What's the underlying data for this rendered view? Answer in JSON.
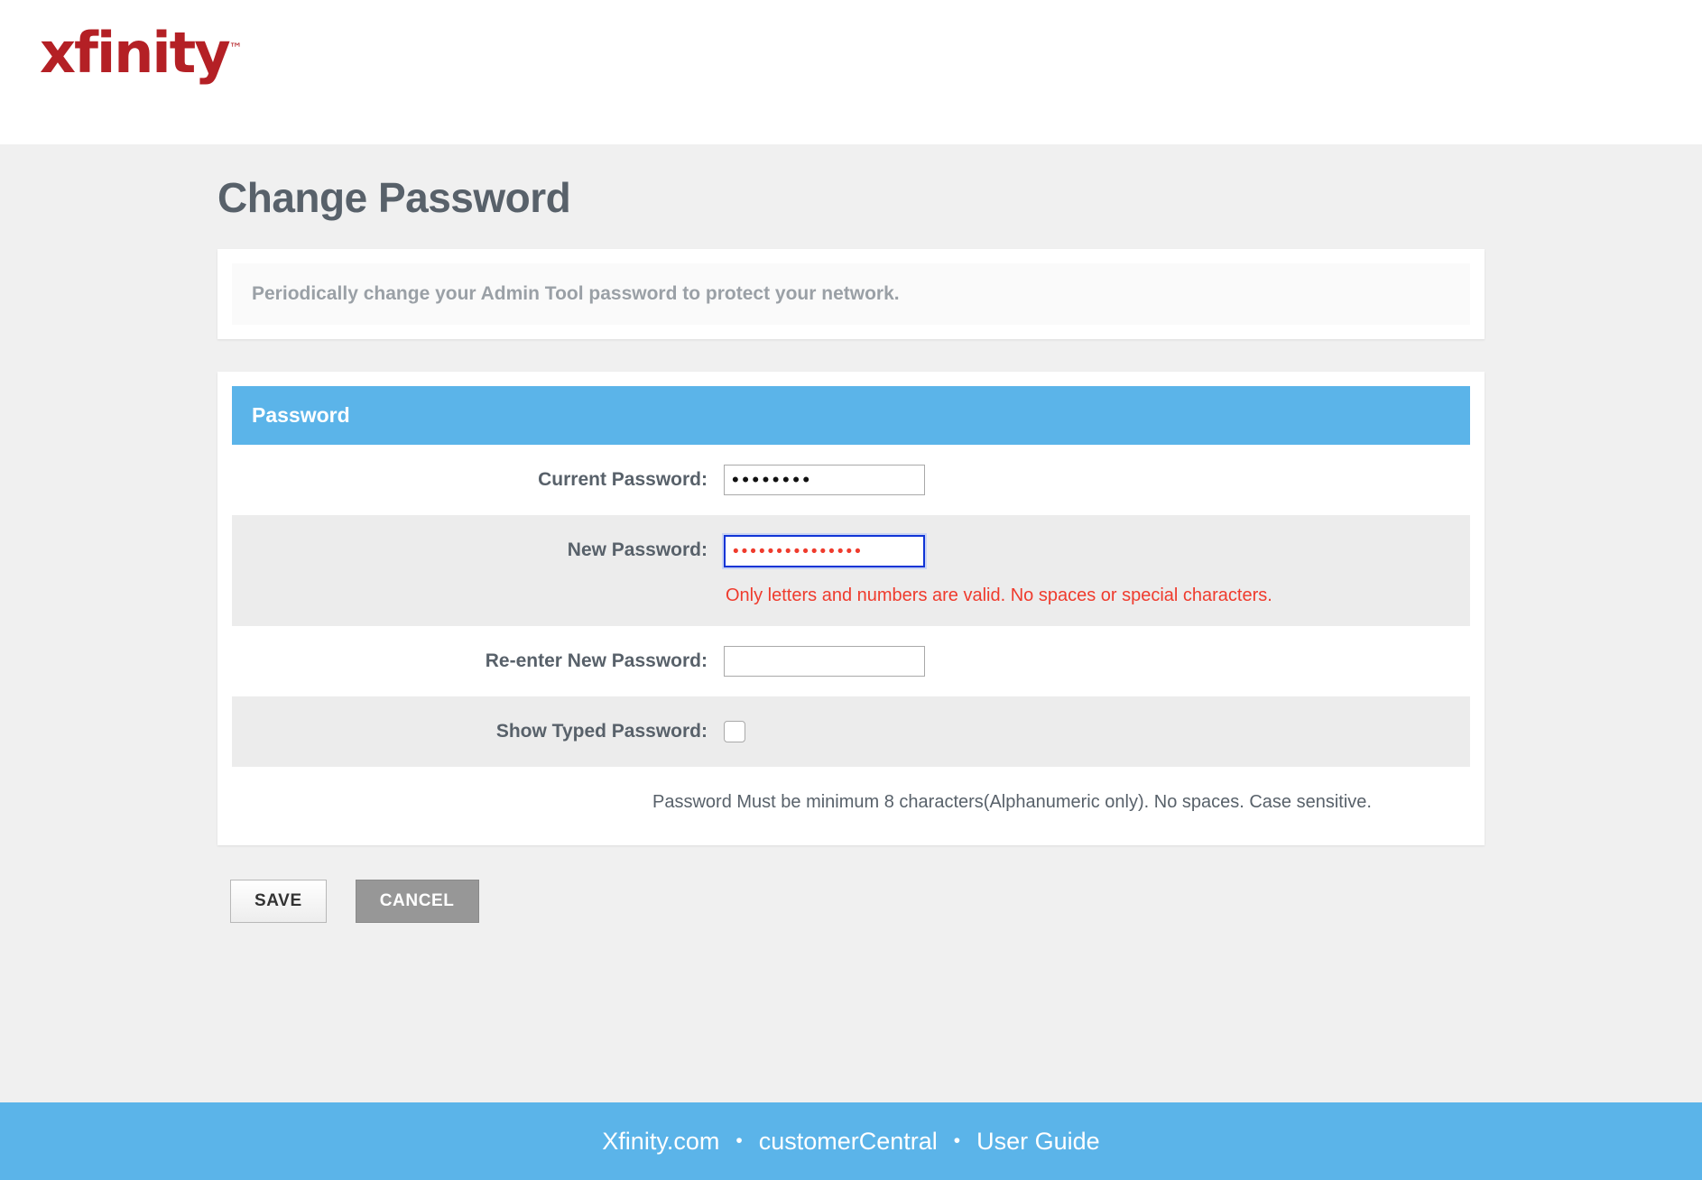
{
  "brand": {
    "logo_text": "xfinity",
    "logo_tm": "™",
    "logo_color": "#b42025"
  },
  "page": {
    "title": "Change Password",
    "info_message": "Periodically change your Admin Tool password to protect your network."
  },
  "panel": {
    "header": "Password",
    "accent_color": "#5bb4e9",
    "rows": [
      {
        "label": "Current Password:",
        "value": "••••••••",
        "placeholder": ""
      },
      {
        "label": "New Password:",
        "value": "•••••••••••••••",
        "placeholder": ""
      },
      {
        "label": "Re-enter New Password:",
        "value": "",
        "placeholder": ""
      },
      {
        "label": "Show Typed Password:"
      }
    ],
    "error_message": "Only letters and numbers are valid. No spaces or special characters.",
    "error_color": "#ef3b2d",
    "hint": "Password Must be minimum 8 characters(Alphanumeric only). No spaces. Case sensitive.",
    "checkbox_checked": false
  },
  "actions": {
    "save_label": "SAVE",
    "cancel_label": "CANCEL"
  },
  "footer": {
    "links": [
      {
        "label": "Xfinity.com"
      },
      {
        "label": "customerCentral"
      },
      {
        "label": "User Guide"
      }
    ],
    "separator": "•",
    "background_color": "#5bb4e9"
  }
}
